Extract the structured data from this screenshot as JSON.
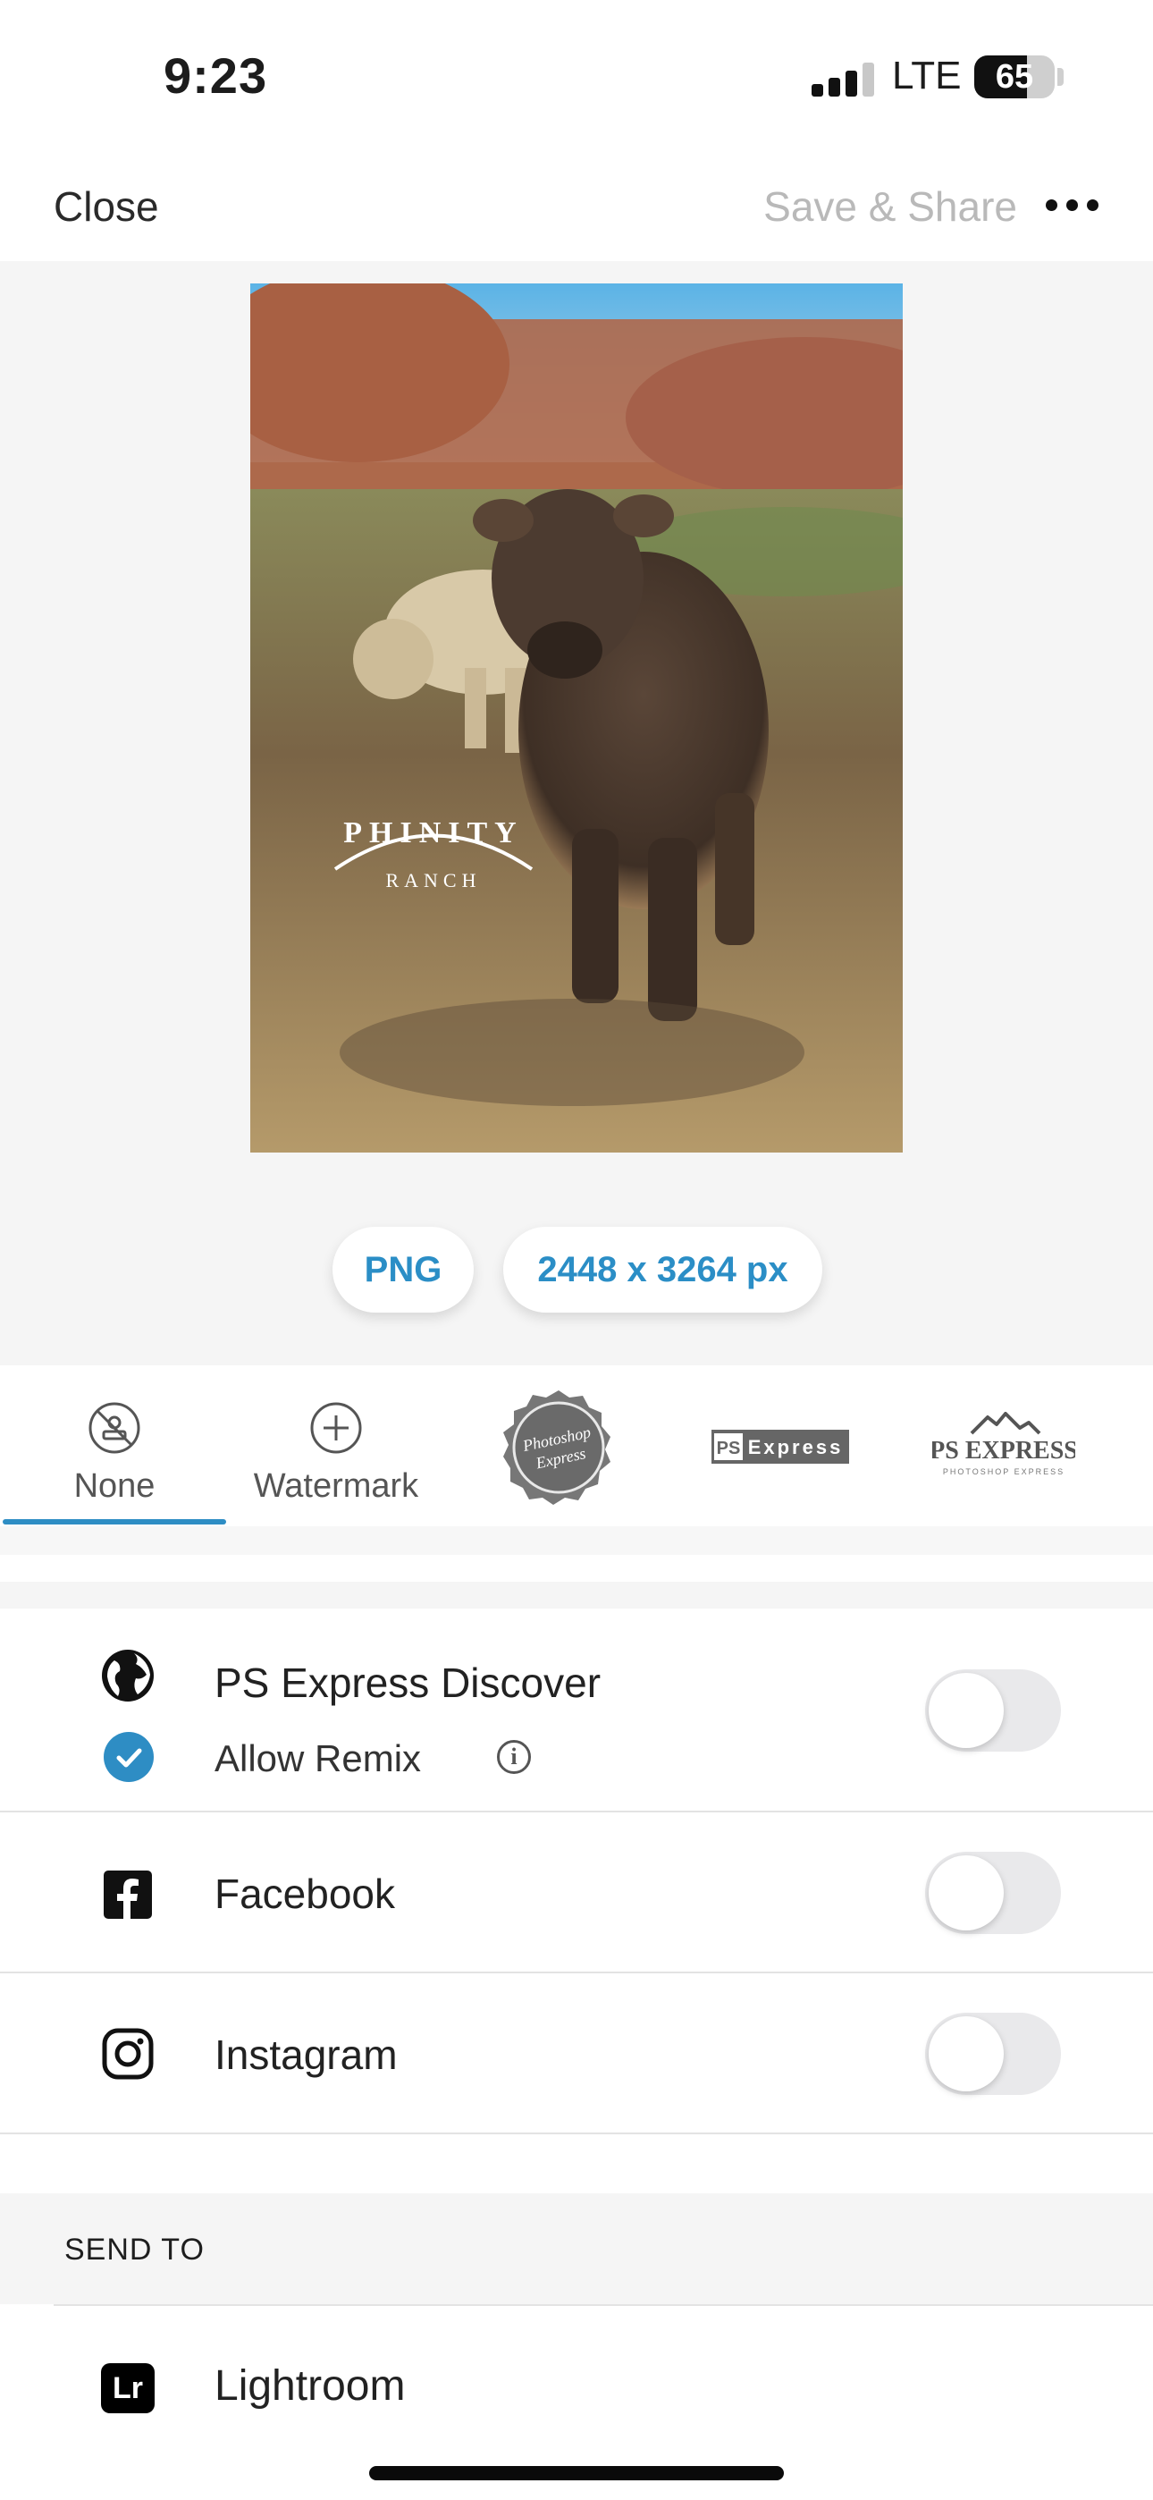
{
  "status_bar": {
    "time": "9:23",
    "network": "LTE",
    "battery_percent": "65",
    "battery_level": 0.65
  },
  "nav": {
    "close_label": "Close",
    "save_share_label": "Save & Share",
    "more_icon": "ellipsis-icon"
  },
  "preview": {
    "watermark_line1": "PHINITY",
    "watermark_line2": "RANCH",
    "format": "PNG",
    "dimensions": "2448 x 3264 px"
  },
  "watermarks": {
    "selected": "None",
    "items": [
      {
        "label": "None",
        "icon": "no-watermark-icon"
      },
      {
        "label": "Watermark",
        "icon": "add-circle-icon"
      },
      {
        "label": "",
        "icon": "photoshop-express-seal-logo"
      },
      {
        "label": "",
        "icon": "ps-express-banner-logo"
      },
      {
        "label": "",
        "icon": "ps-express-mountain-logo"
      }
    ],
    "logo_texts": {
      "seal_line1": "Photoshop",
      "seal_line2": "Express",
      "banner_ps": "PS",
      "banner_word": "Express",
      "mountain_title": "PS EXPRESS",
      "mountain_sub": "PHOTOSHOP EXPRESS"
    }
  },
  "share": {
    "discover": {
      "label": "PS Express Discover",
      "icon": "globe-icon",
      "enabled": false
    },
    "allow_remix": {
      "label": "Allow Remix",
      "checked": true,
      "icon": "info-icon"
    },
    "facebook": {
      "label": "Facebook",
      "icon": "facebook-icon",
      "enabled": false
    },
    "instagram": {
      "label": "Instagram",
      "icon": "instagram-icon",
      "enabled": false
    }
  },
  "send_to": {
    "title": "SEND TO",
    "items": [
      {
        "label": "Lightroom",
        "icon_text": "Lr"
      }
    ]
  },
  "colors": {
    "accent": "#2e8dc4",
    "disabled_text": "#b9b9b9",
    "toggle_off": "#e9e9eb"
  }
}
